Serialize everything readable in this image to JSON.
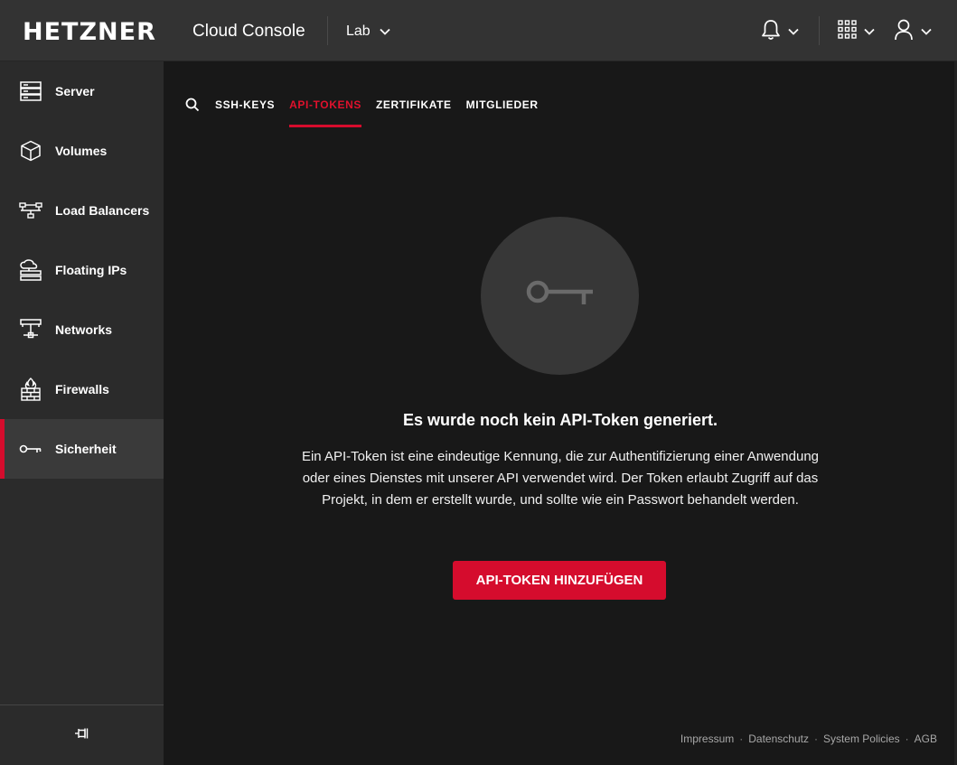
{
  "header": {
    "logo": "HETZNER",
    "product": "Cloud Console",
    "project": "Lab"
  },
  "sidebar": {
    "items": [
      {
        "label": "Server",
        "icon": "server-icon"
      },
      {
        "label": "Volumes",
        "icon": "cube-icon"
      },
      {
        "label": "Load Balancers",
        "icon": "load-balancer-icon"
      },
      {
        "label": "Floating IPs",
        "icon": "floating-ip-icon"
      },
      {
        "label": "Networks",
        "icon": "network-icon"
      },
      {
        "label": "Firewalls",
        "icon": "firewall-icon"
      },
      {
        "label": "Sicherheit",
        "icon": "key-icon",
        "active": true
      }
    ]
  },
  "tabs": [
    {
      "label": "SSH-KEYS"
    },
    {
      "label": "API-TOKENS",
      "active": true
    },
    {
      "label": "ZERTIFIKATE"
    },
    {
      "label": "MITGLIEDER"
    }
  ],
  "empty_state": {
    "title": "Es wurde noch kein API-Token generiert.",
    "description": "Ein API-Token ist eine eindeutige Kennung, die zur Authentifizierung einer Anwendung oder eines Dienstes mit unserer API verwendet wird. Der Token erlaubt Zugriff auf das Projekt, in dem er erstellt wurde, und sollte wie ein Passwort behandelt werden.",
    "button": "API-TOKEN HINZUFÜGEN"
  },
  "footer": {
    "links": [
      "Impressum",
      "Datenschutz",
      "System Policies",
      "AGB"
    ],
    "separator": "·"
  },
  "colors": {
    "accent": "#d50c2d",
    "topbar": "#333333",
    "sidebar": "#2b2b2b",
    "content": "#181818"
  }
}
